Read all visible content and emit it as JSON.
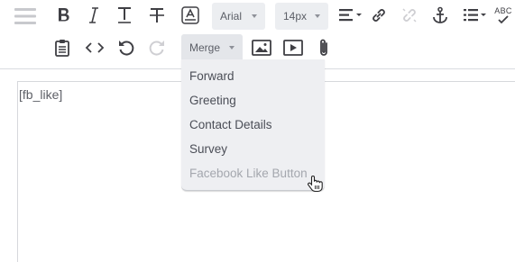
{
  "toolbar": {
    "font_family_value": "Arial",
    "font_size_value": "14px",
    "merge_label": "Merge",
    "spellcheck_label": "ABC"
  },
  "merge_menu": {
    "items": [
      {
        "label": "Forward",
        "disabled": false
      },
      {
        "label": "Greeting",
        "disabled": false
      },
      {
        "label": "Contact Details",
        "disabled": false
      },
      {
        "label": "Survey",
        "disabled": false
      },
      {
        "label": "Facebook Like Button",
        "disabled": true
      }
    ]
  },
  "editor": {
    "content": "[fb_like]"
  },
  "colors": {
    "icon": "#3f3f44",
    "icon_disabled": "#cfcfd3",
    "dropdown_bg": "#eceef1",
    "menu_bg": "#eeeff2",
    "menu_text": "#4b4e57",
    "menu_text_disabled": "#a4a7ae",
    "editor_text": "#5d5f66"
  },
  "icons": [
    "hamburger-icon",
    "bold-icon",
    "italic-icon",
    "underline-icon",
    "strikethrough-icon",
    "text-color-icon",
    "align-icon",
    "link-icon",
    "unlink-icon",
    "anchor-icon",
    "list-icon",
    "spellcheck-icon",
    "clipboard-icon",
    "code-icon",
    "undo-icon",
    "redo-icon",
    "image-icon",
    "video-icon",
    "attachment-icon",
    "hand-pointer-icon"
  ]
}
